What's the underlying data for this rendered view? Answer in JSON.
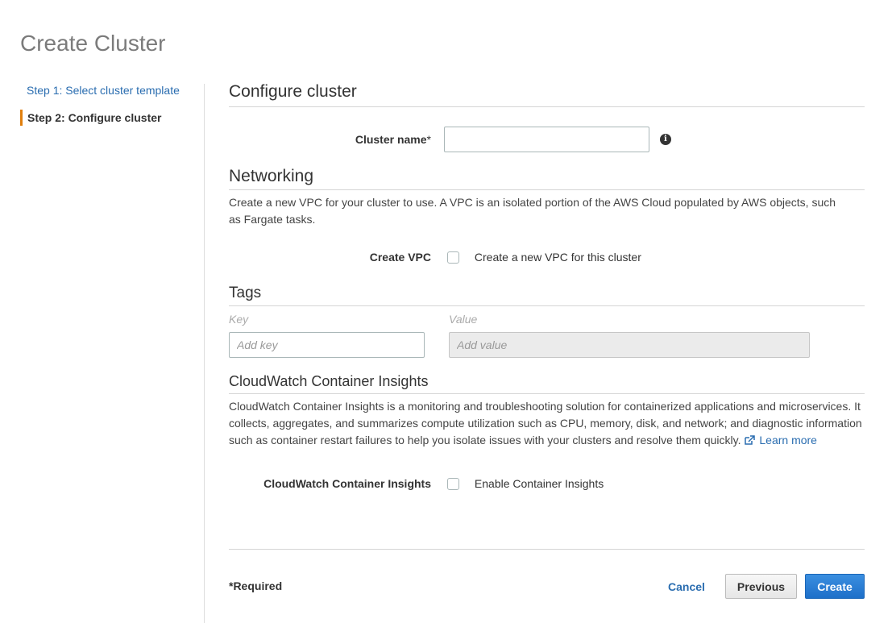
{
  "page": {
    "title": "Create Cluster"
  },
  "steps": [
    {
      "label": "Step 1: Select cluster template"
    },
    {
      "label": "Step 2: Configure cluster"
    }
  ],
  "configure": {
    "heading": "Configure cluster",
    "cluster_name_label": "Cluster name",
    "required_mark": "*",
    "cluster_name_value": ""
  },
  "networking": {
    "heading": "Networking",
    "description": "Create a new VPC for your cluster to use. A VPC is an isolated portion of the AWS Cloud populated by AWS objects, such as Fargate tasks.",
    "create_vpc_label": "Create VPC",
    "create_vpc_checkbox_text": "Create a new VPC for this cluster",
    "create_vpc_checked": false
  },
  "tags": {
    "heading": "Tags",
    "key_header": "Key",
    "value_header": "Value",
    "key_placeholder": "Add key",
    "value_placeholder": "Add value"
  },
  "insights": {
    "heading": "CloudWatch Container Insights",
    "description": "CloudWatch Container Insights is a monitoring and troubleshooting solution for containerized applications and microservices. It collects, aggregates, and summarizes compute utilization such as CPU, memory, disk, and network; and diagnostic information such as container restart failures to help you isolate issues with your clusters and resolve them quickly.",
    "learn_more": "Learn more",
    "label": "CloudWatch Container Insights",
    "checkbox_text": "Enable Container Insights",
    "checked": false
  },
  "footer": {
    "required_note": "*Required",
    "cancel_label": "Cancel",
    "previous_label": "Previous",
    "create_label": "Create"
  },
  "colors": {
    "accent_step": "#e07f0d",
    "link": "#2a6db0",
    "primary_button": "#1d6fc9"
  },
  "icons": {
    "info": "info-icon",
    "external_link": "external-link-icon"
  }
}
